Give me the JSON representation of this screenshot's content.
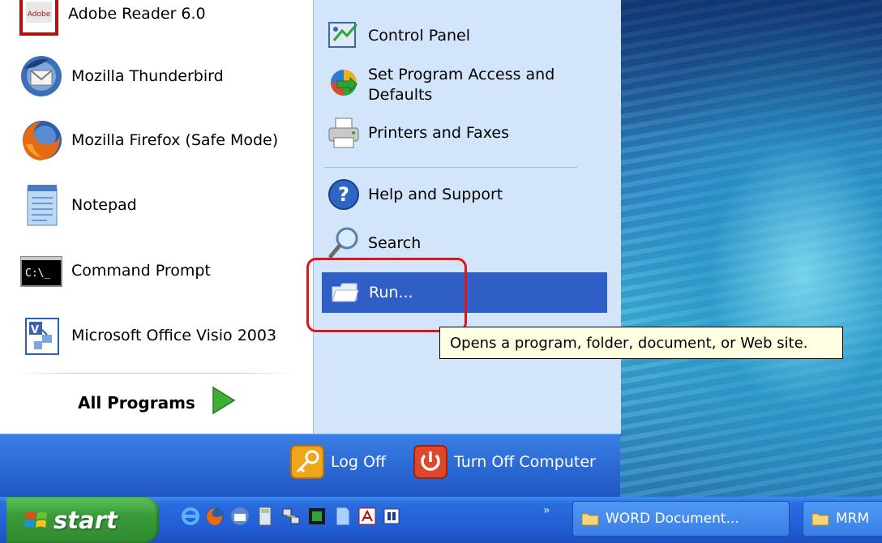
{
  "start_menu": {
    "left_items": [
      {
        "label": "Adobe Reader 6.0",
        "icon": "adobe-reader-icon"
      },
      {
        "label": "Mozilla Thunderbird",
        "icon": "thunderbird-icon"
      },
      {
        "label": "Mozilla Firefox (Safe Mode)",
        "icon": "firefox-icon"
      },
      {
        "label": "Notepad",
        "icon": "notepad-icon"
      },
      {
        "label": "Command Prompt",
        "icon": "command-prompt-icon"
      },
      {
        "label": "Microsoft Office Visio 2003",
        "icon": "visio-icon"
      }
    ],
    "all_programs": "All Programs",
    "right_items": [
      {
        "label": "Control Panel",
        "icon": "control-panel-icon"
      },
      {
        "label": "Set Program Access and",
        "label2": "Defaults",
        "icon": "program-access-icon"
      },
      {
        "label": "Printers and Faxes",
        "icon": "printer-icon"
      },
      {
        "label": "Help and Support",
        "icon": "help-icon"
      },
      {
        "label": "Search",
        "icon": "search-icon"
      },
      {
        "label": "Run...",
        "icon": "run-icon",
        "selected": true
      }
    ],
    "tooltip": "Opens a program, folder, document, or Web site.",
    "log_off": "Log Off",
    "turn_off": "Turn Off Computer"
  },
  "taskbar": {
    "start_label": "start",
    "overflow": "»",
    "tasks": [
      {
        "label": "WORD Document..."
      },
      {
        "label": "MRM"
      }
    ]
  },
  "colors": {
    "menu_left_bg": "#ffffff",
    "menu_right_bg": "#d3e5fa",
    "selected_bg": "#2f5fc6",
    "highlight_ring": "#e01515",
    "tooltip_bg": "#ffffe1",
    "taskbar_blue": "#245fd6",
    "start_green": "#3a9b3a"
  }
}
